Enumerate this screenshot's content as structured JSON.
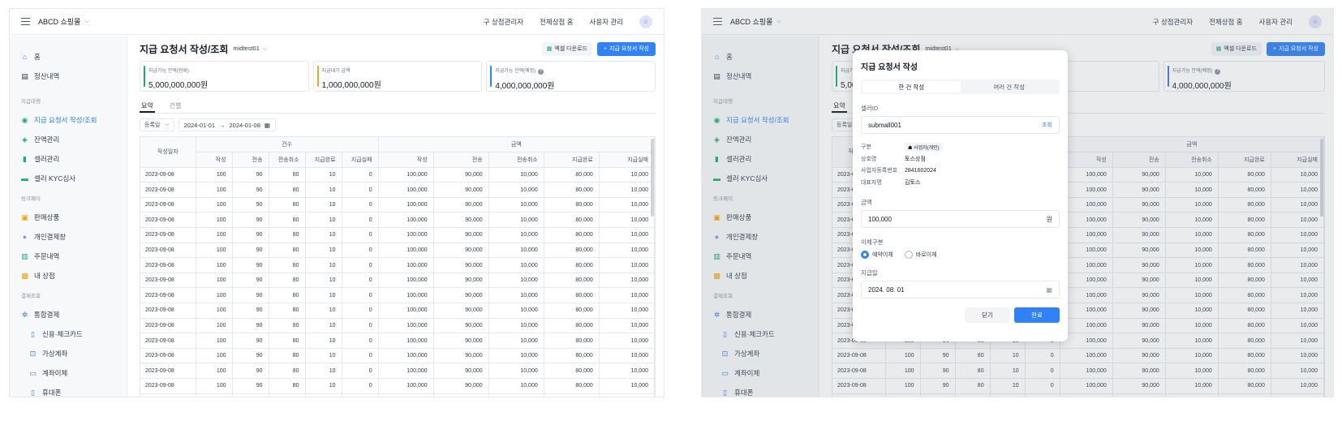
{
  "app": {
    "shop_name": "ABCD 쇼핑몰",
    "nav": [
      "구 상점관리자",
      "전체상점 홈",
      "사용자 관리"
    ]
  },
  "sidebar": {
    "groups": [
      {
        "title": "",
        "items": [
          {
            "label": "홈",
            "icon": "home-icon",
            "color": "#3182f6"
          },
          {
            "label": "정산내역",
            "icon": "ledger-icon",
            "color": "#333d4b"
          }
        ]
      },
      {
        "title": "지급대행",
        "items": [
          {
            "label": "지급 요청서 작성/조회",
            "icon": "payout-icon",
            "color": "#16b364",
            "active": true
          },
          {
            "label": "잔액관리",
            "icon": "wallet-icon",
            "color": "#16b364"
          },
          {
            "label": "셀러관리",
            "icon": "seller-icon",
            "color": "#16b364"
          },
          {
            "label": "셀러 KYC심사",
            "icon": "kyc-icon",
            "color": "#16b364"
          }
        ]
      },
      {
        "title": "링크페이",
        "items": [
          {
            "label": "판매상품",
            "icon": "product-icon",
            "color": "#f59f00"
          },
          {
            "label": "개인결제창",
            "icon": "person-pay-icon",
            "color": "#8b95e8"
          },
          {
            "label": "주문내역",
            "icon": "order-icon",
            "color": "#1aa68a"
          },
          {
            "label": "내 상점",
            "icon": "store-icon",
            "color": "#f59f00"
          }
        ]
      },
      {
        "title": "결제조회",
        "items": [
          {
            "label": "통합결제",
            "icon": "integrated-pay-icon",
            "color": "#3182f6"
          },
          {
            "label": "신용·체크카드",
            "icon": "card-icon",
            "color": "#3182f6",
            "sub": true
          },
          {
            "label": "가상계좌",
            "icon": "virtual-account-icon",
            "color": "#3182f6",
            "sub": true
          },
          {
            "label": "계좌이체",
            "icon": "transfer-icon",
            "color": "#3182f6",
            "sub": true
          },
          {
            "label": "휴대폰",
            "icon": "phone-icon",
            "color": "#3182f6",
            "sub": true
          }
        ]
      }
    ]
  },
  "page": {
    "title": "지급 요청서 작성/조회",
    "merchant": "midtest01",
    "excel_button": "엑셀 다운로드",
    "create_button": "지급 요청서 작성",
    "cards": [
      {
        "label": "지급가능 잔액(현재)",
        "value": "5,000,000,000원",
        "color": "#16b364",
        "info": false
      },
      {
        "label": "지급대기 금액",
        "value": "1,000,000,000원",
        "color": "#f5a623",
        "info": false
      },
      {
        "label": "지급가능 잔액(예정)",
        "value": "4,000,000,000원",
        "color": "#3182f6",
        "info": true
      }
    ],
    "tabs": [
      "요약",
      "건별"
    ],
    "filter": {
      "type": "등록일",
      "start": "2024-01-01",
      "end": "2024-01-08"
    }
  },
  "table": {
    "date_header": "작성일자",
    "group_count": "건수",
    "group_amount": "금액",
    "cols": [
      "작성",
      "전송",
      "전송취소",
      "지급완료",
      "지급실패"
    ],
    "rows": [
      [
        "2023-09-08",
        "100",
        "90",
        "80",
        "10",
        "0",
        "100,000",
        "90,000",
        "10,000",
        "80,000",
        "10,000"
      ],
      [
        "2023-09-08",
        "100",
        "90",
        "80",
        "10",
        "0",
        "100,000",
        "90,000",
        "10,000",
        "80,000",
        "10,000"
      ],
      [
        "2023-09-08",
        "100",
        "90",
        "80",
        "10",
        "0",
        "100,000",
        "90,000",
        "10,000",
        "80,000",
        "10,000"
      ],
      [
        "2023-09-08",
        "100",
        "90",
        "80",
        "10",
        "0",
        "100,000",
        "90,000",
        "10,000",
        "80,000",
        "10,000"
      ],
      [
        "2023-09-08",
        "100",
        "90",
        "80",
        "10",
        "0",
        "100,000",
        "90,000",
        "10,000",
        "80,000",
        "10,000"
      ],
      [
        "2023-09-08",
        "100",
        "90",
        "80",
        "10",
        "0",
        "100,000",
        "90,000",
        "10,000",
        "80,000",
        "10,000"
      ],
      [
        "2023-09-08",
        "100",
        "90",
        "80",
        "10",
        "0",
        "100,000",
        "90,000",
        "10,000",
        "80,000",
        "10,000"
      ],
      [
        "2023-09-08",
        "100",
        "90",
        "80",
        "10",
        "0",
        "100,000",
        "90,000",
        "10,000",
        "80,000",
        "10,000"
      ],
      [
        "2023-09-08",
        "100",
        "90",
        "80",
        "10",
        "0",
        "100,000",
        "90,000",
        "10,000",
        "80,000",
        "10,000"
      ],
      [
        "2023-09-08",
        "100",
        "90",
        "80",
        "10",
        "0",
        "100,000",
        "90,000",
        "10,000",
        "80,000",
        "10,000"
      ],
      [
        "2023-09-08",
        "100",
        "90",
        "80",
        "10",
        "0",
        "100,000",
        "90,000",
        "10,000",
        "80,000",
        "10,000"
      ],
      [
        "2023-09-08",
        "100",
        "90",
        "80",
        "10",
        "0",
        "100,000",
        "90,000",
        "10,000",
        "80,000",
        "10,000"
      ],
      [
        "2023-09-08",
        "100",
        "90",
        "80",
        "10",
        "0",
        "100,000",
        "90,000",
        "10,000",
        "80,000",
        "10,000"
      ],
      [
        "2023-09-08",
        "100",
        "90",
        "80",
        "10",
        "0",
        "100,000",
        "90,000",
        "10,000",
        "80,000",
        "10,000"
      ],
      [
        "2023-09-08",
        "100",
        "90",
        "80",
        "10",
        "0",
        "100,000",
        "90,000",
        "10,000",
        "80,000",
        "10,000"
      ],
      [
        "2023-09-08",
        "100",
        "90",
        "80",
        "10",
        "0",
        "100,000",
        "90,000",
        "10,000",
        "80,000",
        "10,000"
      ]
    ]
  },
  "modal": {
    "title": "지급 요청서 작성",
    "seg": [
      "한 건 작성",
      "여러 건 작성"
    ],
    "seller_label": "셀러ID",
    "seller_value": "submall001",
    "seller_action": "조회",
    "info": [
      {
        "k": "구분",
        "v": "사업자(개인)",
        "tag": true
      },
      {
        "k": "상호명",
        "v": "토스상점"
      },
      {
        "k": "사업자등록번호",
        "v": "2841602024"
      },
      {
        "k": "대표자명",
        "v": "김토스"
      }
    ],
    "amount_label": "금액",
    "amount_value": "100,000",
    "amount_unit": "원",
    "transfer_label": "이체구분",
    "transfer_options": [
      "예약이체",
      "바로이체"
    ],
    "date_label": "지급일",
    "date_value": "2024. 08. 01",
    "cancel": "닫기",
    "ok": "완료"
  }
}
